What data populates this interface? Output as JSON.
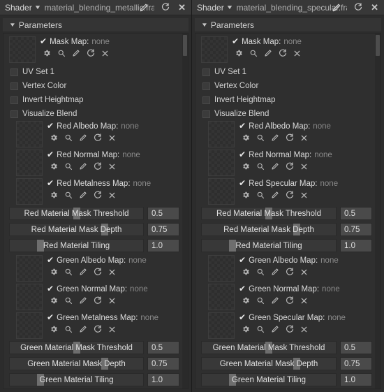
{
  "panels": [
    {
      "titlebar": {
        "label": "Shader",
        "caret": "▼",
        "filename": "material_blending_metallic.frag",
        "pencil_icon": "pencil-icon",
        "reload_icon": "↻",
        "close_icon": "✕"
      },
      "section": {
        "triangle": "▼",
        "title": "Parameters"
      },
      "mask_map": {
        "check": "✔",
        "name": "Mask Map:",
        "value": "none",
        "icons": [
          "gear-icon",
          "search-icon",
          "pencil-icon",
          "reload-icon",
          "clear-icon"
        ]
      },
      "checkboxes": [
        {
          "label": "UV Set 1",
          "checked": false
        },
        {
          "label": "Vertex Color",
          "checked": false
        },
        {
          "label": "Invert Heightmap",
          "checked": false
        },
        {
          "label": "Visualize Blend",
          "checked": false
        }
      ],
      "maps": [
        {
          "check": "✔",
          "name": "Red Albedo Map:",
          "value": "none"
        },
        {
          "check": "✔",
          "name": "Red Normal Map:",
          "value": "none"
        },
        {
          "check": "✔",
          "name": "Red Metalness Map:",
          "value": "none"
        }
      ],
      "sliders": [
        {
          "label": "Red Material Mask Threshold",
          "value": "0.5",
          "pct": 50
        },
        {
          "label": "Red Material Mask Depth",
          "value": "0.75",
          "pct": 71
        },
        {
          "label": "Red Material Tiling",
          "value": "1.0",
          "pct": 23
        }
      ],
      "maps2": [
        {
          "check": "✔",
          "name": "Green Albedo Map:",
          "value": "none"
        },
        {
          "check": "✔",
          "name": "Green Normal Map:",
          "value": "none"
        },
        {
          "check": "✔",
          "name": "Green Metalness Map:",
          "value": "none"
        }
      ],
      "sliders2": [
        {
          "label": "Green Material Mask Threshold",
          "value": "0.5",
          "pct": 50
        },
        {
          "label": "Green Material Mask Depth",
          "value": "0.75",
          "pct": 71
        },
        {
          "label": "Green Material Tiling",
          "value": "1.0",
          "pct": 23
        }
      ]
    },
    {
      "titlebar": {
        "label": "Shader",
        "caret": "▼",
        "filename": "material_blending_specular.frag",
        "pencil_icon": "pencil-icon",
        "reload_icon": "↻",
        "close_icon": "✕"
      },
      "section": {
        "triangle": "▼",
        "title": "Parameters"
      },
      "mask_map": {
        "check": "✔",
        "name": "Mask Map:",
        "value": "none",
        "icons": [
          "gear-icon",
          "search-icon",
          "pencil-icon",
          "reload-icon",
          "clear-icon"
        ]
      },
      "checkboxes": [
        {
          "label": "UV Set 1",
          "checked": false
        },
        {
          "label": "Vertex Color",
          "checked": false
        },
        {
          "label": "Invert Heightmap",
          "checked": false
        },
        {
          "label": "Visualize Blend",
          "checked": false
        }
      ],
      "maps": [
        {
          "check": "✔",
          "name": "Red Albedo Map:",
          "value": "none"
        },
        {
          "check": "✔",
          "name": "Red Normal Map:",
          "value": "none"
        },
        {
          "check": "✔",
          "name": "Red Specular Map:",
          "value": "none"
        }
      ],
      "sliders": [
        {
          "label": "Red Material Mask Threshold",
          "value": "0.5",
          "pct": 50
        },
        {
          "label": "Red Material Mask Depth",
          "value": "0.75",
          "pct": 71
        },
        {
          "label": "Red Material Tiling",
          "value": "1.0",
          "pct": 23
        }
      ],
      "maps2": [
        {
          "check": "✔",
          "name": "Green Albedo Map:",
          "value": "none"
        },
        {
          "check": "✔",
          "name": "Green Normal Map:",
          "value": "none"
        },
        {
          "check": "✔",
          "name": "Green Specular Map:",
          "value": "none"
        }
      ],
      "sliders2": [
        {
          "label": "Green Material Mask Threshold",
          "value": "0.5",
          "pct": 50
        },
        {
          "label": "Green Material Mask Depth",
          "value": "0.75",
          "pct": 71
        },
        {
          "label": "Green Material Tiling",
          "value": "1.0",
          "pct": 23
        }
      ]
    }
  ],
  "colors": {
    "window_bg": "#1b1b1b",
    "panel_bg": "#2c2c2c",
    "titlebar_bg": "#383838",
    "body_bg": "#2f2f2f",
    "slider_track": "#383838",
    "slider_handle": "#6e6e6e",
    "value_field": "#4a4a4a",
    "text": "#dcdcdc",
    "muted_text": "#8a8a8a"
  }
}
